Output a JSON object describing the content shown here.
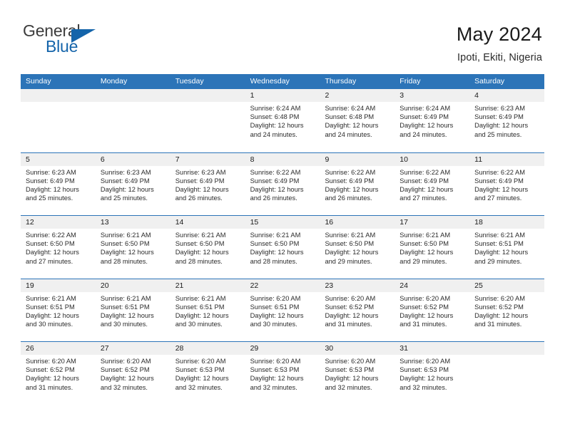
{
  "brand": {
    "name_top": "General",
    "name_bottom": "Blue",
    "accent_color": "#1464aa",
    "triangle_icon": "brand-triangle-icon"
  },
  "header": {
    "title": "May 2024",
    "location": "Ipoti, Ekiti, Nigeria"
  },
  "calendar": {
    "header_bg": "#2c74b8",
    "daynum_bg": "#f0f0f0",
    "weekday_names": [
      "Sunday",
      "Monday",
      "Tuesday",
      "Wednesday",
      "Thursday",
      "Friday",
      "Saturday"
    ],
    "weeks": [
      [
        {
          "day": "",
          "info": ""
        },
        {
          "day": "",
          "info": ""
        },
        {
          "day": "",
          "info": ""
        },
        {
          "day": "1",
          "info": "Sunrise: 6:24 AM\nSunset: 6:48 PM\nDaylight: 12 hours\nand 24 minutes."
        },
        {
          "day": "2",
          "info": "Sunrise: 6:24 AM\nSunset: 6:48 PM\nDaylight: 12 hours\nand 24 minutes."
        },
        {
          "day": "3",
          "info": "Sunrise: 6:24 AM\nSunset: 6:49 PM\nDaylight: 12 hours\nand 24 minutes."
        },
        {
          "day": "4",
          "info": "Sunrise: 6:23 AM\nSunset: 6:49 PM\nDaylight: 12 hours\nand 25 minutes."
        }
      ],
      [
        {
          "day": "5",
          "info": "Sunrise: 6:23 AM\nSunset: 6:49 PM\nDaylight: 12 hours\nand 25 minutes."
        },
        {
          "day": "6",
          "info": "Sunrise: 6:23 AM\nSunset: 6:49 PM\nDaylight: 12 hours\nand 25 minutes."
        },
        {
          "day": "7",
          "info": "Sunrise: 6:23 AM\nSunset: 6:49 PM\nDaylight: 12 hours\nand 26 minutes."
        },
        {
          "day": "8",
          "info": "Sunrise: 6:22 AM\nSunset: 6:49 PM\nDaylight: 12 hours\nand 26 minutes."
        },
        {
          "day": "9",
          "info": "Sunrise: 6:22 AM\nSunset: 6:49 PM\nDaylight: 12 hours\nand 26 minutes."
        },
        {
          "day": "10",
          "info": "Sunrise: 6:22 AM\nSunset: 6:49 PM\nDaylight: 12 hours\nand 27 minutes."
        },
        {
          "day": "11",
          "info": "Sunrise: 6:22 AM\nSunset: 6:49 PM\nDaylight: 12 hours\nand 27 minutes."
        }
      ],
      [
        {
          "day": "12",
          "info": "Sunrise: 6:22 AM\nSunset: 6:50 PM\nDaylight: 12 hours\nand 27 minutes."
        },
        {
          "day": "13",
          "info": "Sunrise: 6:21 AM\nSunset: 6:50 PM\nDaylight: 12 hours\nand 28 minutes."
        },
        {
          "day": "14",
          "info": "Sunrise: 6:21 AM\nSunset: 6:50 PM\nDaylight: 12 hours\nand 28 minutes."
        },
        {
          "day": "15",
          "info": "Sunrise: 6:21 AM\nSunset: 6:50 PM\nDaylight: 12 hours\nand 28 minutes."
        },
        {
          "day": "16",
          "info": "Sunrise: 6:21 AM\nSunset: 6:50 PM\nDaylight: 12 hours\nand 29 minutes."
        },
        {
          "day": "17",
          "info": "Sunrise: 6:21 AM\nSunset: 6:50 PM\nDaylight: 12 hours\nand 29 minutes."
        },
        {
          "day": "18",
          "info": "Sunrise: 6:21 AM\nSunset: 6:51 PM\nDaylight: 12 hours\nand 29 minutes."
        }
      ],
      [
        {
          "day": "19",
          "info": "Sunrise: 6:21 AM\nSunset: 6:51 PM\nDaylight: 12 hours\nand 30 minutes."
        },
        {
          "day": "20",
          "info": "Sunrise: 6:21 AM\nSunset: 6:51 PM\nDaylight: 12 hours\nand 30 minutes."
        },
        {
          "day": "21",
          "info": "Sunrise: 6:21 AM\nSunset: 6:51 PM\nDaylight: 12 hours\nand 30 minutes."
        },
        {
          "day": "22",
          "info": "Sunrise: 6:20 AM\nSunset: 6:51 PM\nDaylight: 12 hours\nand 30 minutes."
        },
        {
          "day": "23",
          "info": "Sunrise: 6:20 AM\nSunset: 6:52 PM\nDaylight: 12 hours\nand 31 minutes."
        },
        {
          "day": "24",
          "info": "Sunrise: 6:20 AM\nSunset: 6:52 PM\nDaylight: 12 hours\nand 31 minutes."
        },
        {
          "day": "25",
          "info": "Sunrise: 6:20 AM\nSunset: 6:52 PM\nDaylight: 12 hours\nand 31 minutes."
        }
      ],
      [
        {
          "day": "26",
          "info": "Sunrise: 6:20 AM\nSunset: 6:52 PM\nDaylight: 12 hours\nand 31 minutes."
        },
        {
          "day": "27",
          "info": "Sunrise: 6:20 AM\nSunset: 6:52 PM\nDaylight: 12 hours\nand 32 minutes."
        },
        {
          "day": "28",
          "info": "Sunrise: 6:20 AM\nSunset: 6:53 PM\nDaylight: 12 hours\nand 32 minutes."
        },
        {
          "day": "29",
          "info": "Sunrise: 6:20 AM\nSunset: 6:53 PM\nDaylight: 12 hours\nand 32 minutes."
        },
        {
          "day": "30",
          "info": "Sunrise: 6:20 AM\nSunset: 6:53 PM\nDaylight: 12 hours\nand 32 minutes."
        },
        {
          "day": "31",
          "info": "Sunrise: 6:20 AM\nSunset: 6:53 PM\nDaylight: 12 hours\nand 32 minutes."
        },
        {
          "day": "",
          "info": ""
        }
      ]
    ]
  }
}
